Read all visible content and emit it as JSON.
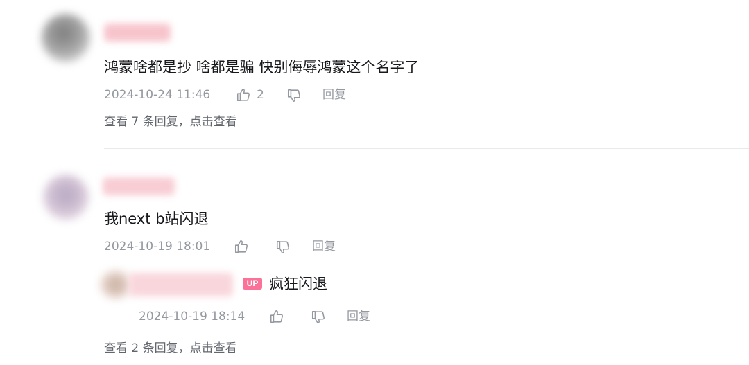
{
  "comments": [
    {
      "content": "鸿蒙啥都是抄 啥都是骗 快别侮辱鸿蒙这个名字了",
      "timestamp": "2024-10-24 11:46",
      "like_count": "2",
      "reply_label": "回复",
      "view_replies": "查看 7 条回复，点击查看"
    },
    {
      "content": "我next b站闪退",
      "timestamp": "2024-10-19 18:01",
      "reply_label": "回复",
      "sub_reply": {
        "badge": "UP",
        "badge_color": "#fb7299",
        "content": "疯狂闪退",
        "timestamp": "2024-10-19 18:14",
        "reply_label": "回复"
      },
      "view_replies": "查看 2 条回复，点击查看"
    }
  ],
  "icons": {
    "like": "thumbs-up-icon",
    "dislike": "thumbs-down-icon"
  },
  "colors": {
    "text_primary": "#18191c",
    "text_meta": "#9499a0",
    "text_view": "#61666d",
    "divider": "#e8e9ec"
  }
}
